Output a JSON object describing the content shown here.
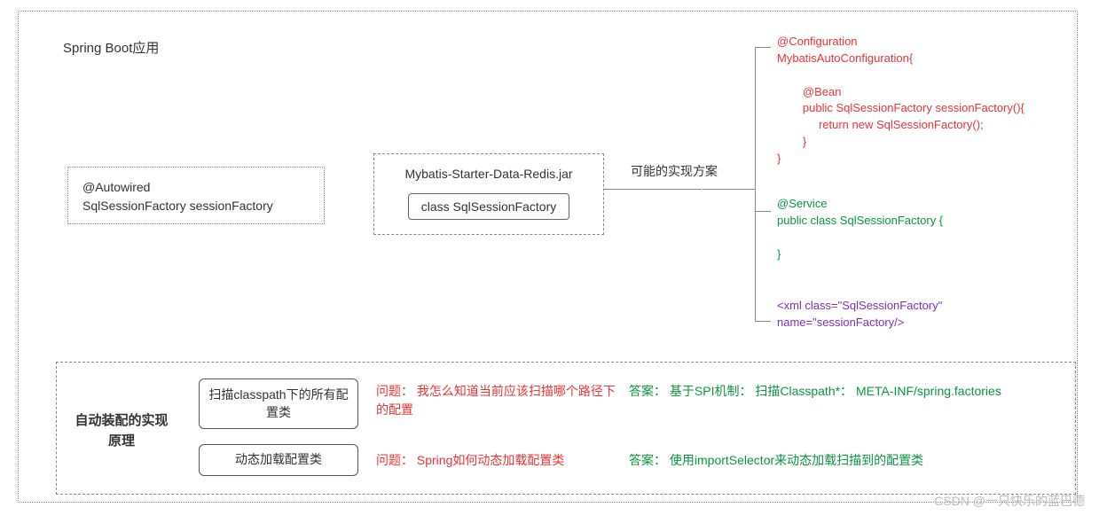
{
  "title": "Spring Boot应用",
  "autowired": {
    "line1": "@Autowired",
    "line2": "SqlSessionFactory sessionFactory"
  },
  "jar": {
    "name": "Mybatis-Starter-Data-Redis.jar",
    "innerClass": "class  SqlSessionFactory"
  },
  "possible": "可能的实现方案",
  "impl": {
    "config": "@Configuration\nMybatisAutoConfiguration{\n\n        @Bean\n        public SqlSessionFactory sessionFactory(){\n             return new SqlSessionFactory();\n        }\n}",
    "service": "@Service\npublic class SqlSessionFactory {\n\n}",
    "xml": "<xml class=\"SqlSessionFactory\"\nname=\"sessionFactory/>"
  },
  "bottom": {
    "title": "自动装配的实现原理",
    "row1": {
      "btn": "扫描classpath下的所有配置类",
      "qLabel": "问题：",
      "qText": "我怎么知道当前应该扫描哪个路径下的配置",
      "aLabel": "答案：",
      "aText": "基于SPI机制： 扫描Classpath*： META-INF/spring.factories"
    },
    "row2": {
      "btn": "动态加载配置类",
      "qLabel": "问题：",
      "qText": "Spring如何动态加载配置类",
      "aLabel": "答案：",
      "aText": "使用importSelector来动态加载扫描到的配置类"
    }
  },
  "watermark": "CSDN @一只快乐的蓝巴德"
}
